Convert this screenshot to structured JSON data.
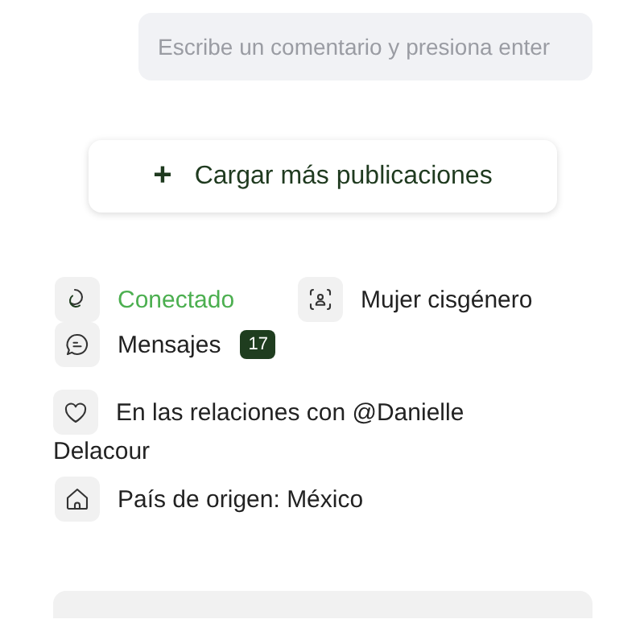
{
  "comment_field": {
    "placeholder": "Escribe un comentario y presiona enter"
  },
  "load_more_button": {
    "icon": "+",
    "label": "Cargar más publicaciones"
  },
  "profile_info": [
    {
      "kind": "status",
      "label": "Conectado",
      "online": true
    },
    {
      "kind": "gender",
      "label": "Mujer cisgénero"
    },
    {
      "kind": "messages",
      "label": "Mensajes",
      "count": "17"
    }
  ],
  "relationship": {
    "lines": [
      "En las relaciones con @Danielle",
      "Delacour"
    ]
  },
  "origin": {
    "text": "País de origen: México"
  },
  "search_field": {
    "kind": "search"
  }
}
